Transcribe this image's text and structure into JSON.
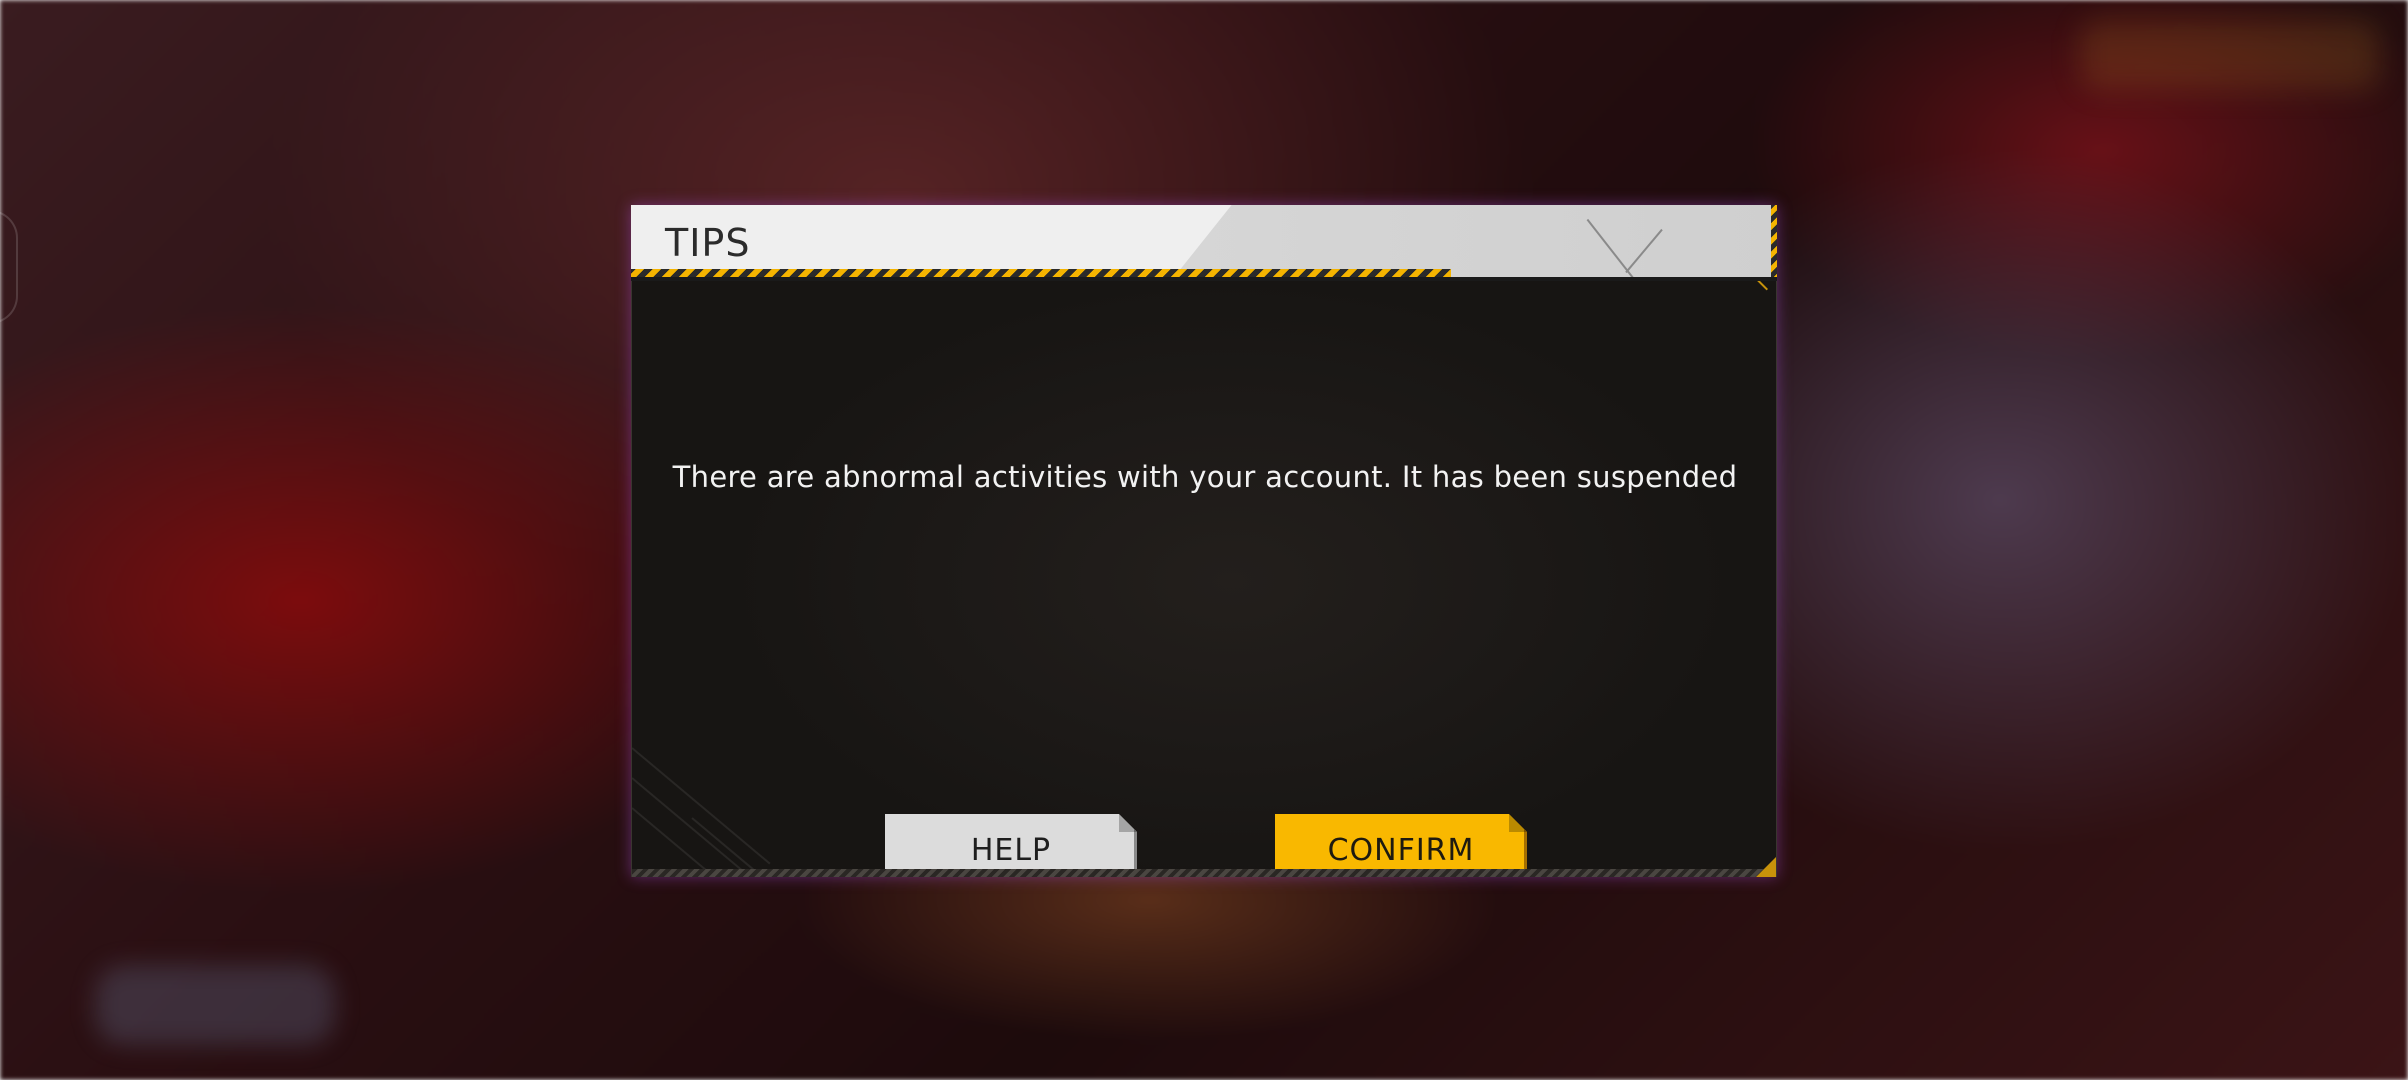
{
  "dialog": {
    "title": "TIPS",
    "message": "There are abnormal activities with your account. It has been suspended",
    "buttons": {
      "help_label": "HELP",
      "confirm_label": "CONFIRM"
    }
  },
  "colors": {
    "accent": "#f9b800",
    "header_bg": "#efefef",
    "body_bg": "#1c1917",
    "help_button_bg": "#dcdcdc"
  }
}
